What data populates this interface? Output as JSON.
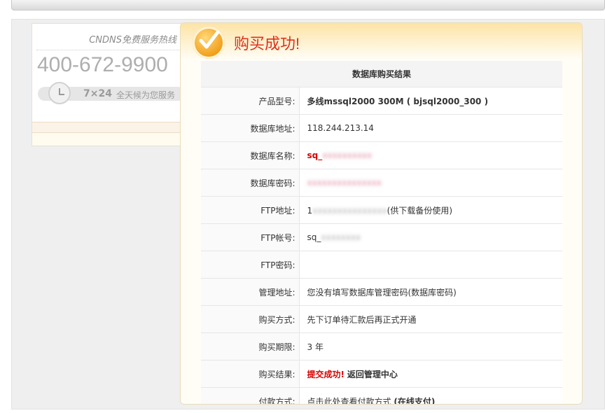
{
  "sidebar": {
    "hotline_label": "CNDNS免费服务热线",
    "phone": "400-672-9900",
    "service_hours": "7×24",
    "service_text": "全天候为您服务"
  },
  "main": {
    "title": "购买成功!",
    "table_title": "数据库购买结果",
    "rows": [
      {
        "label": "产品型号:",
        "value": "多线mssql2000 300M ( bjsql2000_300 )"
      },
      {
        "label": "数据库地址:",
        "value": "118.244.213.14"
      },
      {
        "label": "数据库名称:",
        "value_prefix": "sq_",
        "value_hidden": "xxxxxxxxxx"
      },
      {
        "label": "数据库密码:",
        "value_hidden": "xxxxxxxxxxxxxxx"
      },
      {
        "label": "FTP地址:",
        "value_prefix": "1",
        "value_hidden": "xxxxxxxxxxxxxxx",
        "value_suffix": "(供下载备份使用)"
      },
      {
        "label": "FTP帐号:",
        "value_prefix": "sq_",
        "value_hidden": "xxxxxxxx"
      },
      {
        "label": "FTP密码:",
        "value": ""
      },
      {
        "label": "管理地址:",
        "value": "您没有填写数据库管理密码(数据库密码)"
      },
      {
        "label": "购买方式:",
        "value": "先下订单待汇款后再正式开通"
      },
      {
        "label": "购买期限:",
        "value": "3 年"
      },
      {
        "label": "购买结果:",
        "result": "提交成功!",
        "link": "返回管理中心"
      },
      {
        "label": "付款方式:",
        "text": "点击此处查看付款方式",
        "link": "(在线支付)"
      }
    ]
  }
}
